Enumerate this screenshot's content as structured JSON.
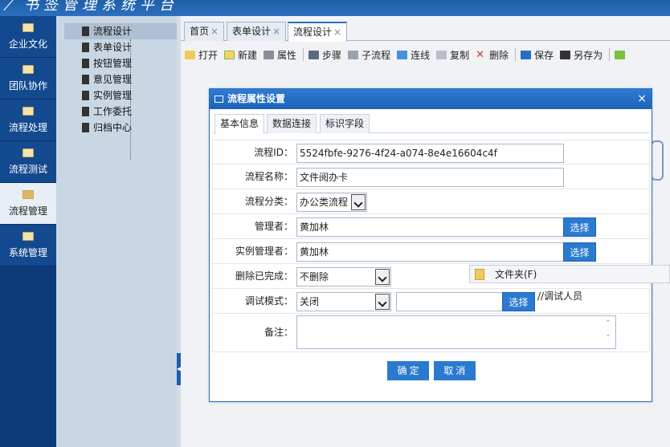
{
  "topbar": {
    "title": "书签管理系统平台"
  },
  "leftnav": [
    {
      "label": "企业文化"
    },
    {
      "label": "团队协作"
    },
    {
      "label": "流程处理"
    },
    {
      "label": "流程测试"
    },
    {
      "label": "流程管理"
    },
    {
      "label": "系统管理"
    }
  ],
  "tree": [
    {
      "label": "流程设计"
    },
    {
      "label": "表单设计"
    },
    {
      "label": "按钮管理"
    },
    {
      "label": "意见管理"
    },
    {
      "label": "实例管理"
    },
    {
      "label": "工作委托"
    },
    {
      "label": "归档中心"
    }
  ],
  "tabs": [
    {
      "label": "首页",
      "close": "×"
    },
    {
      "label": "表单设计",
      "close": "×"
    },
    {
      "label": "流程设计",
      "close": "×"
    }
  ],
  "toolbar": {
    "open": "打开",
    "new": "新建",
    "props": "属性",
    "step": "步骤",
    "subflow": "子流程",
    "link": "连线",
    "copy": "复制",
    "delete": "删除",
    "save": "保存",
    "saveas": "另存为"
  },
  "dialog": {
    "title": "流程属性设置",
    "close": "×",
    "tabs": [
      "基本信息",
      "数据连接",
      "标识字段"
    ],
    "fields": {
      "flow_id_label": "流程ID：",
      "flow_id_value": "5524fbfe-9276-4f24-a074-8e4e16604c4f",
      "flow_name_label": "流程名称：",
      "flow_name_value": "文件阅办卡",
      "category_label": "流程分类：",
      "category_value": "办公类流程",
      "manager_label": "管理者：",
      "manager_value": "黄加林",
      "instance_manager_label": "实例管理者：",
      "instance_manager_value": "黄加林",
      "delete_done_label": "删除已完成：",
      "delete_done_value": "不删除",
      "debug_label": "调试模式：",
      "debug_value": "关闭",
      "debug_user_value": "",
      "debug_hint": "//调试人员",
      "note_label": "备注：",
      "note_value": ""
    },
    "select_button": "选择",
    "ok_button": "确定",
    "cancel_button": "取消"
  },
  "context_popup": {
    "label": "文件夹(F)"
  }
}
